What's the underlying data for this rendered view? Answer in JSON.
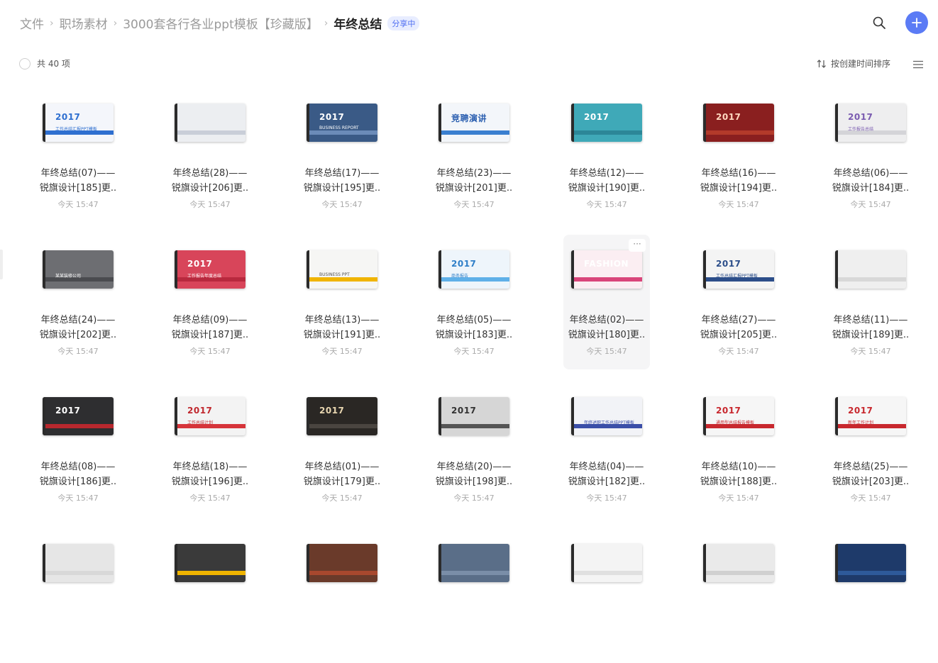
{
  "breadcrumb": {
    "items": [
      "文件",
      "职场素材",
      "3000套各行各业ppt模板【珍藏版】"
    ],
    "current": "年终总结",
    "badge": "分享中"
  },
  "toolbar": {
    "count_label": "共 40 项",
    "sort_label": "按创建时间排序"
  },
  "icons": {
    "search": "search-icon",
    "add": "plus-icon",
    "sort": "sort-arrows-icon",
    "view": "list-view-icon",
    "more": "more-dots-icon"
  },
  "accent_color": "#5b7bf5",
  "files": [
    {
      "line1": "年终总结(07)——",
      "line2": "锐旗设计[185]更..",
      "time": "今天 15:47",
      "thumb": {
        "bg": "#f4f6fb",
        "fg": "#2e6fd0",
        "accent": "#2e6fd0",
        "title": "2017",
        "sub": "工作总结汇报PPT模板"
      }
    },
    {
      "line1": "年终总结(28)——",
      "line2": "锐旗设计[206]更..",
      "time": "今天 15:47",
      "thumb": {
        "bg": "#eceef1",
        "fg": "#5b6f9e",
        "accent": "#c9ced8",
        "title": "",
        "sub": ""
      }
    },
    {
      "line1": "年终总结(17)——",
      "line2": "锐旗设计[195]更..",
      "time": "今天 15:47",
      "thumb": {
        "bg": "#3a5a86",
        "fg": "#ffffff",
        "accent": "#6b8bb8",
        "title": "2017",
        "sub": "BUSINESS REPORT"
      }
    },
    {
      "line1": "年终总结(23)——",
      "line2": "锐旗设计[201]更..",
      "time": "今天 15:47",
      "thumb": {
        "bg": "#f3f6fa",
        "fg": "#2b5fb0",
        "accent": "#3a7fd0",
        "title": "竞聘演讲",
        "sub": ""
      }
    },
    {
      "line1": "年终总结(12)——",
      "line2": "锐旗设计[190]更..",
      "time": "今天 15:47",
      "thumb": {
        "bg": "#3fa9b8",
        "fg": "#ffffff",
        "accent": "#2c8798",
        "title": "2017",
        "sub": ""
      }
    },
    {
      "line1": "年终总结(16)——",
      "line2": "锐旗设计[194]更..",
      "time": "今天 15:47",
      "thumb": {
        "bg": "#8a1f1f",
        "fg": "#ffd8c0",
        "accent": "#b33a2a",
        "title": "2017",
        "sub": ""
      }
    },
    {
      "line1": "年终总结(06)——",
      "line2": "锐旗设计[184]更..",
      "time": "今天 15:47",
      "thumb": {
        "bg": "#eeeeef",
        "fg": "#7a5bb0",
        "accent": "#d4d4d8",
        "title": "2017",
        "sub": "工作报告总结"
      }
    },
    {
      "line1": "年终总结(24)——",
      "line2": "锐旗设计[202]更..",
      "time": "今天 15:47",
      "thumb": {
        "bg": "#6d6e72",
        "fg": "#ffffff",
        "accent": "#4a4b4f",
        "title": "",
        "sub": "某某装修公司"
      }
    },
    {
      "line1": "年终总结(09)——",
      "line2": "锐旗设计[187]更..",
      "time": "今天 15:47",
      "thumb": {
        "bg": "#d8455a",
        "fg": "#ffffff",
        "accent": "#b8293e",
        "title": "2017",
        "sub": "工作报告年度总结"
      }
    },
    {
      "line1": "年终总结(13)——",
      "line2": "锐旗设计[191]更..",
      "time": "今天 15:47",
      "thumb": {
        "bg": "#f6f6f4",
        "fg": "#555555",
        "accent": "#f0b400",
        "title": "",
        "sub": "BUSINESS PPT"
      }
    },
    {
      "line1": "年终总结(05)——",
      "line2": "锐旗设计[183]更..",
      "time": "今天 15:47",
      "thumb": {
        "bg": "#eef5fb",
        "fg": "#2f7fc8",
        "accent": "#5fb0e8",
        "title": "2017",
        "sub": "商务报告"
      }
    },
    {
      "line1": "年终总结(02)——",
      "line2": "锐旗设计[180]更..",
      "time": "今天 15:47",
      "hover": true,
      "thumb": {
        "bg": "#fbeef2",
        "fg": "#ffffff",
        "accent": "#d9457a",
        "title": "FASHION",
        "sub": ""
      }
    },
    {
      "line1": "年终总结(27)——",
      "line2": "锐旗设计[205]更..",
      "time": "今天 15:47",
      "thumb": {
        "bg": "#f4f4f4",
        "fg": "#2c4e8a",
        "accent": "#2c4e8a",
        "title": "2017",
        "sub": "工作总结汇报PPT模板"
      }
    },
    {
      "line1": "年终总结(11)——",
      "line2": "锐旗设计[189]更..",
      "time": "今天 15:47",
      "thumb": {
        "bg": "#efefef",
        "fg": "#888888",
        "accent": "#d8d8d8",
        "title": "",
        "sub": ""
      }
    },
    {
      "line1": "年终总结(08)——",
      "line2": "锐旗设计[186]更..",
      "time": "今天 15:47",
      "thumb": {
        "bg": "#2e2e30",
        "fg": "#ffffff",
        "accent": "#b8282e",
        "title": "2017",
        "sub": ""
      }
    },
    {
      "line1": "年终总结(18)——",
      "line2": "锐旗设计[196]更..",
      "time": "今天 15:47",
      "thumb": {
        "bg": "#f3f3f3",
        "fg": "#c0282e",
        "accent": "#d6343a",
        "title": "2017",
        "sub": "工作总结计划"
      }
    },
    {
      "line1": "年终总结(01)——",
      "line2": "锐旗设计[179]更..",
      "time": "今天 15:47",
      "thumb": {
        "bg": "#2a2724",
        "fg": "#e8d6b0",
        "accent": "#4a4540",
        "title": "2017",
        "sub": ""
      }
    },
    {
      "line1": "年终总结(20)——",
      "line2": "锐旗设计[198]更..",
      "time": "今天 15:47",
      "thumb": {
        "bg": "#d6d6d6",
        "fg": "#333333",
        "accent": "#555555",
        "title": "2017",
        "sub": ""
      }
    },
    {
      "line1": "年终总结(04)——",
      "line2": "锐旗设计[182]更..",
      "time": "今天 15:47",
      "thumb": {
        "bg": "#f2f3f7",
        "fg": "#3b4fa8",
        "accent": "#3b4fa8",
        "title": "",
        "sub": "年终述职工作总结PPT模板"
      }
    },
    {
      "line1": "年终总结(10)——",
      "line2": "锐旗设计[188]更..",
      "time": "今天 15:47",
      "thumb": {
        "bg": "#f6f6f6",
        "fg": "#c8282e",
        "accent": "#c8282e",
        "title": "2017",
        "sub": "通用型总结报告模板"
      }
    },
    {
      "line1": "年终总结(25)——",
      "line2": "锐旗设计[203]更..",
      "time": "今天 15:47",
      "thumb": {
        "bg": "#f6f6f6",
        "fg": "#c8282e",
        "accent": "#c8282e",
        "title": "2017",
        "sub": "新年工作计划"
      }
    },
    {
      "line1": "",
      "line2": "",
      "time": "",
      "thumb": {
        "bg": "#e6e6e6",
        "fg": "#c8282e",
        "accent": "#d8d8d8",
        "title": "",
        "sub": ""
      }
    },
    {
      "line1": "",
      "line2": "",
      "time": "",
      "thumb": {
        "bg": "#3a3a3a",
        "fg": "#f0b400",
        "accent": "#f0b400",
        "title": "",
        "sub": ""
      }
    },
    {
      "line1": "",
      "line2": "",
      "time": "",
      "thumb": {
        "bg": "#6a3a2a",
        "fg": "#ffffff",
        "accent": "#a8482e",
        "title": "",
        "sub": ""
      }
    },
    {
      "line1": "",
      "line2": "",
      "time": "",
      "thumb": {
        "bg": "#5a6e88",
        "fg": "#ffffff",
        "accent": "#7a8ea8",
        "title": "",
        "sub": ""
      }
    },
    {
      "line1": "",
      "line2": "",
      "time": "",
      "thumb": {
        "bg": "#f4f4f4",
        "fg": "#333333",
        "accent": "#e0e0e0",
        "title": "",
        "sub": ""
      }
    },
    {
      "line1": "",
      "line2": "",
      "time": "",
      "thumb": {
        "bg": "#eaeaea",
        "fg": "#3aa0c8",
        "accent": "#d0d0d0",
        "title": "",
        "sub": ""
      }
    },
    {
      "line1": "",
      "line2": "",
      "time": "",
      "thumb": {
        "bg": "#1e3a6a",
        "fg": "#ffffff",
        "accent": "#2e5a9a",
        "title": "",
        "sub": ""
      }
    }
  ]
}
